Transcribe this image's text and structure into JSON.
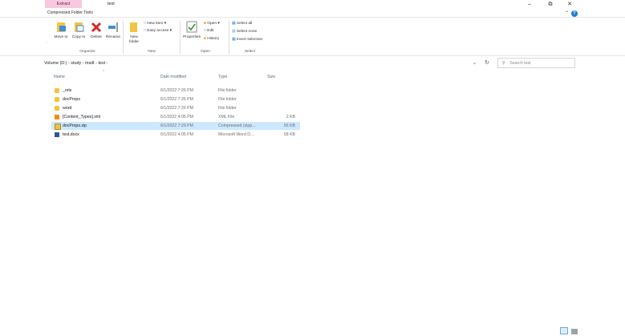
{
  "titlebar": {
    "context_tab": "Extract",
    "title": "test",
    "context_group": "Compressed Folder Tools",
    "min_icon": "minimize-icon",
    "max_icon": "maximize-icon",
    "close_icon": "close-icon"
  },
  "ribbon": {
    "organize": {
      "move_to": "Move to",
      "copy_to": "Copy to",
      "delete": "Delete",
      "rename": "Rename",
      "label": "Organize"
    },
    "new": {
      "new_folder": "New folder",
      "new_item": "New item",
      "easy_access": "Easy access",
      "label": "New"
    },
    "open": {
      "properties": "Properties",
      "open": "Open",
      "edit": "Edit",
      "history": "History",
      "label": "Open"
    },
    "select": {
      "select_all": "Select all",
      "select_none": "Select none",
      "invert_selection": "Invert selection",
      "label": "Select"
    }
  },
  "address": {
    "crumbs": [
      "Volume (D:)",
      "study",
      "msdt",
      "test"
    ],
    "search_placeholder": "Search test"
  },
  "columns": {
    "name": "Name",
    "date": "Date modified",
    "type": "Type",
    "size": "Size"
  },
  "files": [
    {
      "name": "_rels",
      "date": "6/1/2022 7:26 PM",
      "type": "File folder",
      "size": "",
      "icon": "folder-icon"
    },
    {
      "name": "docProps",
      "date": "6/1/2022 7:26 PM",
      "type": "File folder",
      "size": "",
      "icon": "folder-icon"
    },
    {
      "name": "word",
      "date": "6/1/2022 7:26 PM",
      "type": "File folder",
      "size": "",
      "icon": "folder-icon"
    },
    {
      "name": "[Content_Types].xml",
      "date": "6/1/2022 4:05 PM",
      "type": "XML File",
      "size": "2 KB",
      "icon": "xml-file-icon"
    },
    {
      "name": "docProps.zip",
      "date": "6/1/2022 7:29 PM",
      "type": "Compressed (zipp...",
      "size": "56 KB",
      "icon": "zip-file-icon",
      "selected": true
    },
    {
      "name": "test.docx",
      "date": "6/1/2022 4:05 PM",
      "type": "Microsoft Word D...",
      "size": "58 KB",
      "icon": "word-file-icon"
    }
  ],
  "colors": {
    "accent": "#1e7ad3",
    "context_tab_bg": "#f9c8e0",
    "selection": "#cce8ff"
  }
}
